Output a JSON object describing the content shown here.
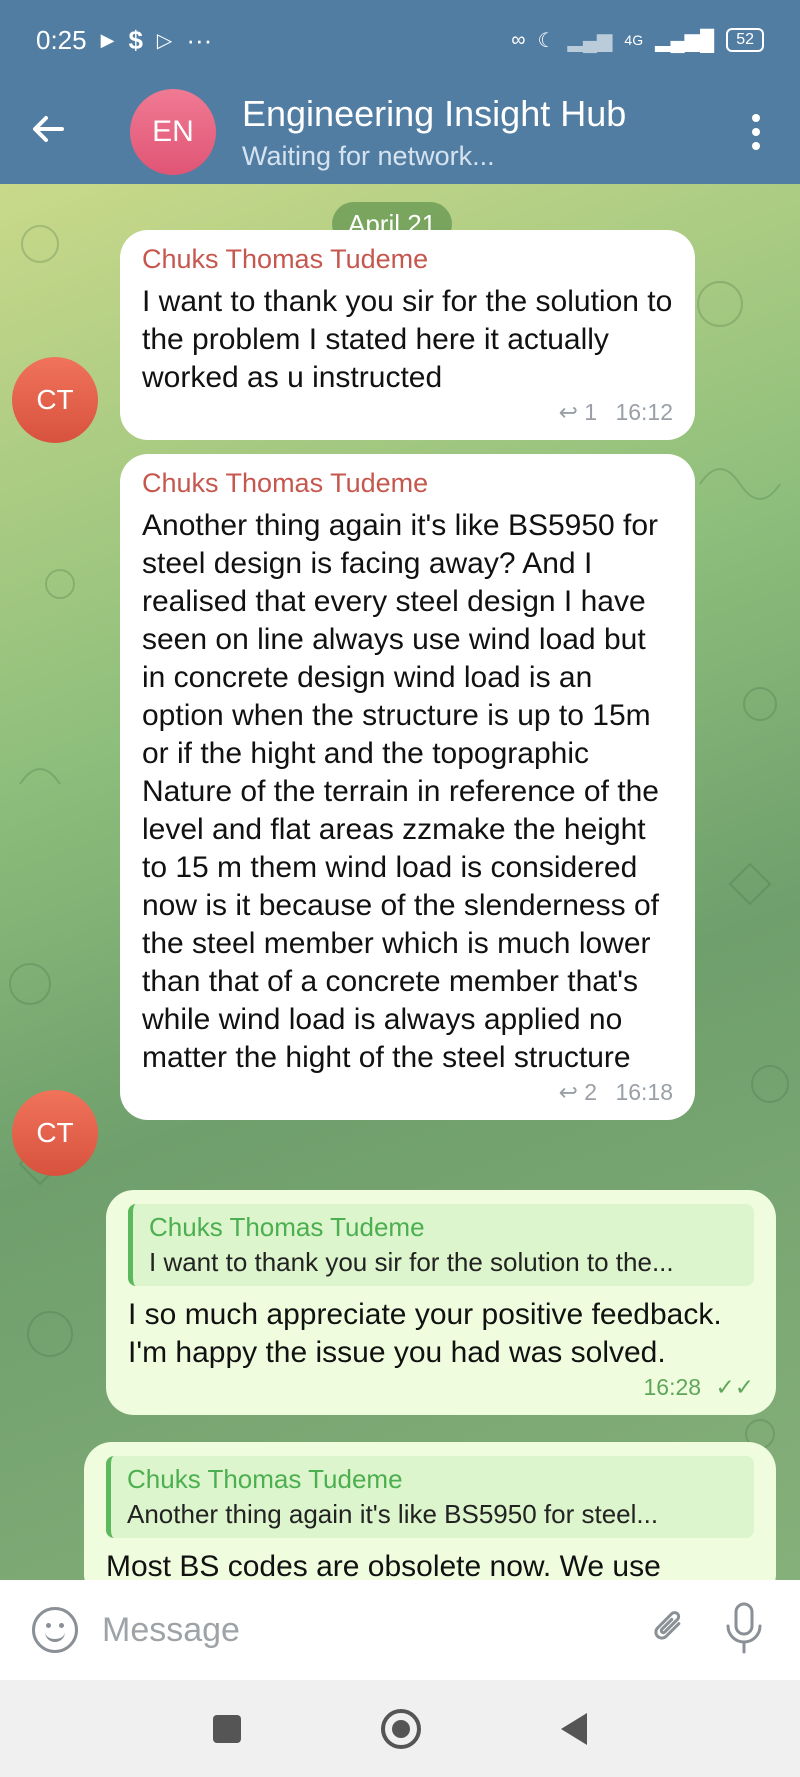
{
  "status_bar": {
    "time": "0:25",
    "network": "4G",
    "battery": "52"
  },
  "header": {
    "avatar_initials": "EN",
    "title": "Engineering Insight Hub",
    "subtitle": "Waiting for network..."
  },
  "chat": {
    "date_chip": "April 21",
    "messages": [
      {
        "avatar": "CT",
        "sender": "Chuks Thomas Tudeme",
        "text": "I want to thank you sir for the solution to the problem I stated here it actually worked as u instructed",
        "replies": "1",
        "time": "16:12"
      },
      {
        "avatar": "CT",
        "sender": "Chuks Thomas Tudeme",
        "text": "Another thing again it's like BS5950 for steel design is facing away? And I realised that every steel design I have seen on line always use wind load but in concrete design wind load is an option when the structure is up to 15m or if the hight and the topographic Nature  of the terrain in reference of the level and flat areas zzmake the height to 15 m them wind load is considered now is it because of the slenderness of the steel member which is much lower than that of a concrete member that's while wind load is always applied no matter the hight of the steel structure",
        "replies": "2",
        "time": "16:18"
      },
      {
        "quote_name": "Chuks Thomas Tudeme",
        "quote_text": "I want to thank you sir for the solution to the...",
        "text": "I so much appreciate your positive feedback. I'm happy the issue you had was solved.",
        "time": "16:28"
      },
      {
        "quote_name": "Chuks Thomas Tudeme",
        "quote_text": "Another thing again it's like BS5950 for steel...",
        "text": "Most BS codes are obsolete now. We use"
      }
    ]
  },
  "input": {
    "placeholder": "Message"
  },
  "icons": {
    "back": "arrow-left-icon",
    "menu": "more-vertical-icon",
    "emoji": "smile-icon",
    "attach": "paperclip-icon",
    "mic": "microphone-icon"
  },
  "colors": {
    "header_bg": "#527da3",
    "sender_name": "#c6574e",
    "outgoing_bubble": "#effdde",
    "quote_accent": "#5cb85c"
  }
}
